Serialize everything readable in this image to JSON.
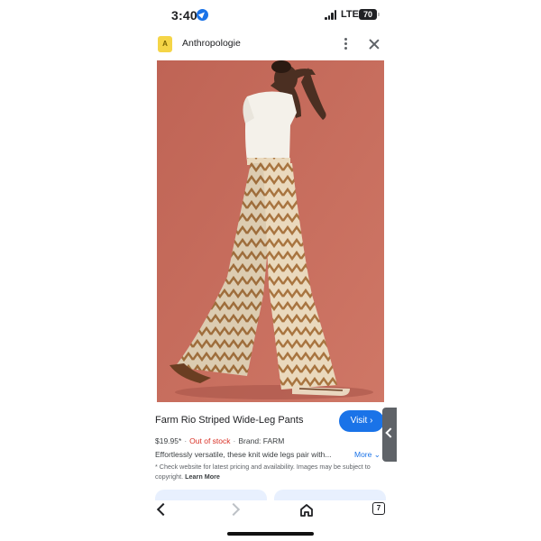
{
  "status_bar": {
    "time": "3:40",
    "network": "LTE",
    "battery": "70"
  },
  "header": {
    "favicon_letter": "A",
    "site_name": "Anthropologie",
    "more_icon": "more-vert-icon",
    "close_icon": "close-icon"
  },
  "product": {
    "image_alt": "",
    "title": "Farm Rio Striped Wide-Leg Pants",
    "price": "$19.95*",
    "stock": "Out of stock",
    "brand": "Brand: FARM",
    "description": "Effortlessly versatile, these knit wide legs pair with...",
    "more_label": "More",
    "disclaimer": "* Check website for latest pricing and availability. Images may be subject to copyright.",
    "learn_more": "Learn More"
  },
  "actions": {
    "visit_label": "Visit ›"
  },
  "bottom_nav": {
    "tabs_count": "7"
  },
  "colors": {
    "accent": "#1a73e8",
    "out_of_stock": "#d93025",
    "backdrop": "#c46a5c"
  }
}
